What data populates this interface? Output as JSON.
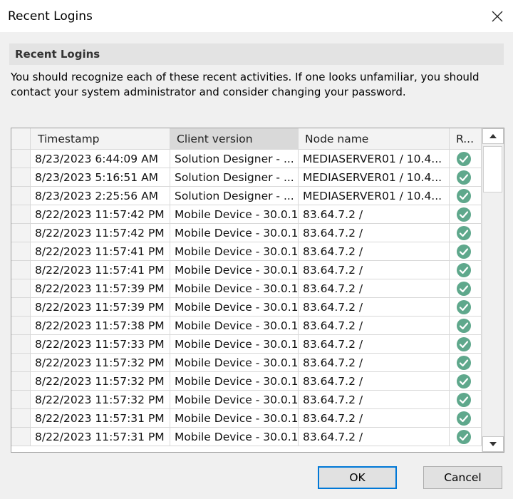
{
  "window": {
    "title": "Recent Logins",
    "close_icon": "close-icon"
  },
  "section": {
    "heading": "Recent Logins"
  },
  "description": "You should recognize each of these recent activities. If one looks unfamiliar, you should contact your system administrator and consider changing your password.",
  "table": {
    "columns": [
      "Timestamp",
      "Client version",
      "Node name",
      "R..."
    ],
    "sorted_column": "Client version",
    "rows": [
      {
        "timestamp": "8/23/2023 6:44:09 AM",
        "client": "Solution Designer - ...",
        "node": "MEDIASERVER01 / 10.4...",
        "result": "ok"
      },
      {
        "timestamp": "8/23/2023 5:16:51 AM",
        "client": "Solution Designer - ...",
        "node": "MEDIASERVER01 / 10.4...",
        "result": "ok"
      },
      {
        "timestamp": "8/23/2023 2:25:56 AM",
        "client": "Solution Designer - ...",
        "node": "MEDIASERVER01 / 10.4...",
        "result": "ok"
      },
      {
        "timestamp": "8/22/2023 11:57:42 PM",
        "client": "Mobile Device - 30.0.1",
        "node": "83.64.7.2 /",
        "result": "ok"
      },
      {
        "timestamp": "8/22/2023 11:57:42 PM",
        "client": "Mobile Device - 30.0.1",
        "node": "83.64.7.2 /",
        "result": "ok"
      },
      {
        "timestamp": "8/22/2023 11:57:41 PM",
        "client": "Mobile Device - 30.0.1",
        "node": "83.64.7.2 /",
        "result": "ok"
      },
      {
        "timestamp": "8/22/2023 11:57:41 PM",
        "client": "Mobile Device - 30.0.1",
        "node": "83.64.7.2 /",
        "result": "ok"
      },
      {
        "timestamp": "8/22/2023 11:57:39 PM",
        "client": "Mobile Device - 30.0.1",
        "node": "83.64.7.2 /",
        "result": "ok"
      },
      {
        "timestamp": "8/22/2023 11:57:39 PM",
        "client": "Mobile Device - 30.0.1",
        "node": "83.64.7.2 /",
        "result": "ok"
      },
      {
        "timestamp": "8/22/2023 11:57:38 PM",
        "client": "Mobile Device - 30.0.1",
        "node": "83.64.7.2 /",
        "result": "ok"
      },
      {
        "timestamp": "8/22/2023 11:57:33 PM",
        "client": "Mobile Device - 30.0.1",
        "node": "83.64.7.2 /",
        "result": "ok"
      },
      {
        "timestamp": "8/22/2023 11:57:32 PM",
        "client": "Mobile Device - 30.0.1",
        "node": "83.64.7.2 /",
        "result": "ok"
      },
      {
        "timestamp": "8/22/2023 11:57:32 PM",
        "client": "Mobile Device - 30.0.1",
        "node": "83.64.7.2 /",
        "result": "ok"
      },
      {
        "timestamp": "8/22/2023 11:57:32 PM",
        "client": "Mobile Device - 30.0.1",
        "node": "83.64.7.2 /",
        "result": "ok"
      },
      {
        "timestamp": "8/22/2023 11:57:31 PM",
        "client": "Mobile Device - 30.0.1",
        "node": "83.64.7.2 /",
        "result": "ok"
      },
      {
        "timestamp": "8/22/2023 11:57:31 PM",
        "client": "Mobile Device - 30.0.1",
        "node": "83.64.7.2 /",
        "result": "ok"
      }
    ],
    "status_icon": "check-circle-icon",
    "status_color": "#5fa88c"
  },
  "buttons": {
    "ok": "OK",
    "cancel": "Cancel"
  },
  "colors": {
    "accent": "#0078d7"
  }
}
